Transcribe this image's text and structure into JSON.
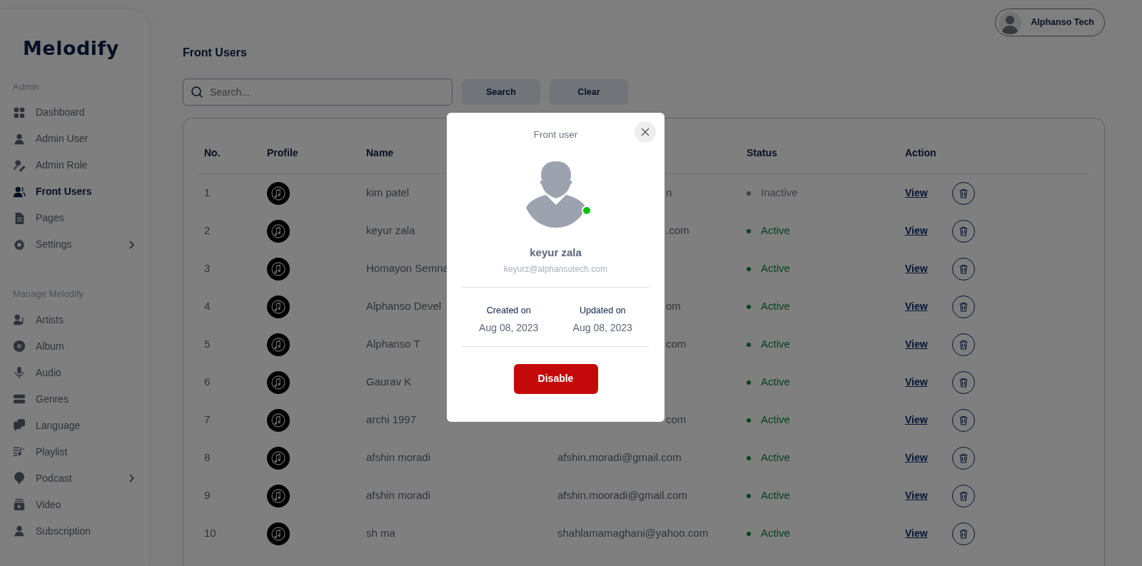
{
  "sidebar": {
    "logo": "Melodify",
    "sections": [
      {
        "title": "Admin",
        "items": [
          {
            "label": "Dashboard",
            "kind": "link",
            "selected": false
          },
          {
            "label": "Admin User",
            "kind": "link",
            "selected": false
          },
          {
            "label": "Admin Role",
            "kind": "link",
            "selected": false
          },
          {
            "label": "Front Users",
            "kind": "link",
            "selected": true
          },
          {
            "label": "Pages",
            "kind": "link",
            "selected": false
          },
          {
            "label": "Settings",
            "kind": "group",
            "selected": false
          }
        ]
      },
      {
        "title": "Manage Melodify",
        "items": [
          {
            "label": "Artists",
            "kind": "link",
            "selected": false
          },
          {
            "label": "Album",
            "kind": "link",
            "selected": false
          },
          {
            "label": "Audio",
            "kind": "link",
            "selected": false
          },
          {
            "label": "Genres",
            "kind": "link",
            "selected": false
          },
          {
            "label": "Language",
            "kind": "link",
            "selected": false
          },
          {
            "label": "Playlist",
            "kind": "link",
            "selected": false
          },
          {
            "label": "Podcast",
            "kind": "group",
            "selected": false
          },
          {
            "label": "Video",
            "kind": "link",
            "selected": false
          },
          {
            "label": "Subscription",
            "kind": "link",
            "selected": false
          }
        ]
      }
    ]
  },
  "user_menu": {
    "name": "Alphanso Tech"
  },
  "page_title": "Front Users",
  "search": {
    "placeholder": "Search...",
    "buttons": [
      "Search",
      "Clear"
    ]
  },
  "table": {
    "columns": [
      "No.",
      "Profile",
      "Name",
      "Status",
      "Action"
    ],
    "rows": [
      {
        "no": "1",
        "name": "kim patel",
        "email": "n",
        "status": "Inactive",
        "active": false,
        "action": "View"
      },
      {
        "no": "2",
        "name": "keyur zala",
        "email": ".com",
        "status": "Active",
        "active": true,
        "action": "View"
      },
      {
        "no": "3",
        "name": "Homayon Semna",
        "status": "Active",
        "active": true,
        "action": "View"
      },
      {
        "no": "4",
        "name": "Alphanso Devel",
        "email": "om",
        "status": "Active",
        "active": true,
        "action": "View"
      },
      {
        "no": "5",
        "name": "Alphanso T",
        "email": "com",
        "status": "Active",
        "active": true,
        "action": "View"
      },
      {
        "no": "6",
        "name": "Gaurav K",
        "status": "Active",
        "active": true,
        "action": "View"
      },
      {
        "no": "7",
        "name": "archi 1997",
        "email": "com",
        "status": "Active",
        "active": true,
        "action": "View"
      },
      {
        "no": "8",
        "name": "afshin moradi",
        "email": "afshin.moradi@gmail.com",
        "status": "Active",
        "active": true,
        "action": "View"
      },
      {
        "no": "9",
        "name": "afshin moradi",
        "email": "afshin.mooradi@gmail.com",
        "status": "Active",
        "active": true,
        "action": "View"
      },
      {
        "no": "10",
        "name": "sh ma",
        "email": "shahlamamaghani@yahoo.com",
        "status": "Active",
        "active": true,
        "action": "View"
      }
    ]
  },
  "modal": {
    "title": "Front user",
    "online": true,
    "name": "keyur zala",
    "email": "keyurz@alphansotech.com",
    "dates": [
      {
        "label": "Created on",
        "value": "Aug 08, 2023"
      },
      {
        "label": "Updated on",
        "value": "Aug 08, 2023"
      }
    ],
    "button": "Disable"
  }
}
